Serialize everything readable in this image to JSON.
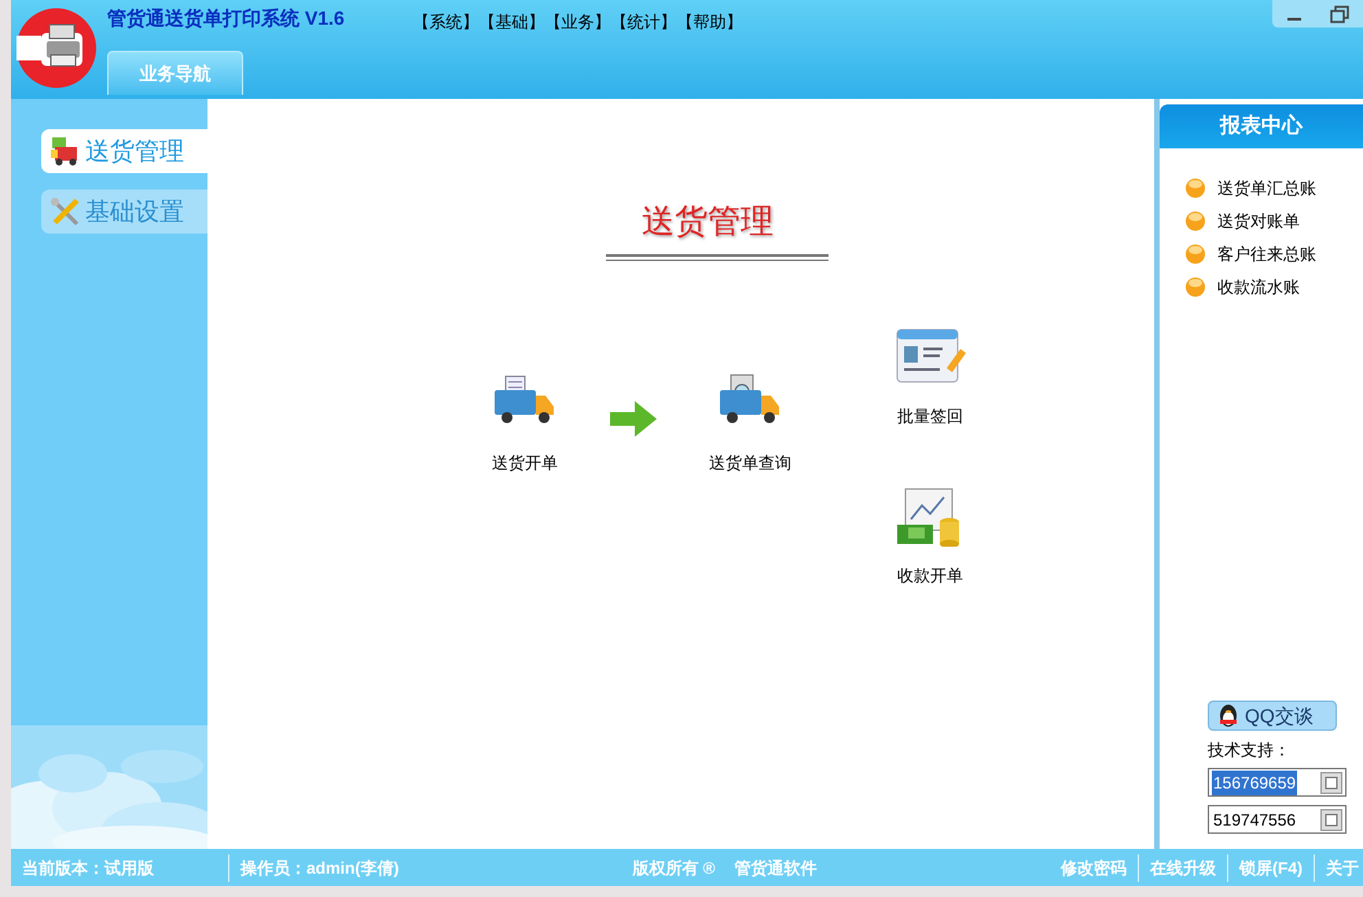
{
  "app": {
    "title": "管货通送货单打印系统 V1.6",
    "menu": [
      "【系统】",
      "【基础】",
      "【业务】",
      "【统计】",
      "【帮助】"
    ]
  },
  "nav_tabs": [
    {
      "label": "业务导航",
      "selected": true
    }
  ],
  "sidebar": {
    "items": [
      {
        "label": "送货管理",
        "selected": true,
        "kind": "delivery"
      },
      {
        "label": "基础设置",
        "selected": false,
        "kind": "settings"
      }
    ]
  },
  "main": {
    "heading": "送货管理",
    "actions": [
      {
        "label": "送货开单",
        "kind": "truck-form"
      },
      {
        "label": "送货单查询",
        "kind": "truck-search"
      },
      {
        "label": "批量签回",
        "kind": "card"
      },
      {
        "label": "收款开单",
        "kind": "money"
      }
    ]
  },
  "report_center": {
    "title": "报表中心",
    "items": [
      "送货单汇总账",
      "送货对账单",
      "客户往来总账",
      "收款流水账"
    ]
  },
  "support": {
    "qq_button": "QQ交谈",
    "label": "技术支持：",
    "numbers": [
      {
        "value": "156769659",
        "selected": true
      },
      {
        "value": "519747556",
        "selected": false
      }
    ]
  },
  "status_bar": {
    "version": "当前版本：试用版",
    "operator": "操作员：admin(李倩)",
    "copyright": "版权所有 ®",
    "company": "管货通软件",
    "links": [
      "修改密码",
      "在线升级",
      "锁屏(F4)",
      "关于"
    ]
  }
}
